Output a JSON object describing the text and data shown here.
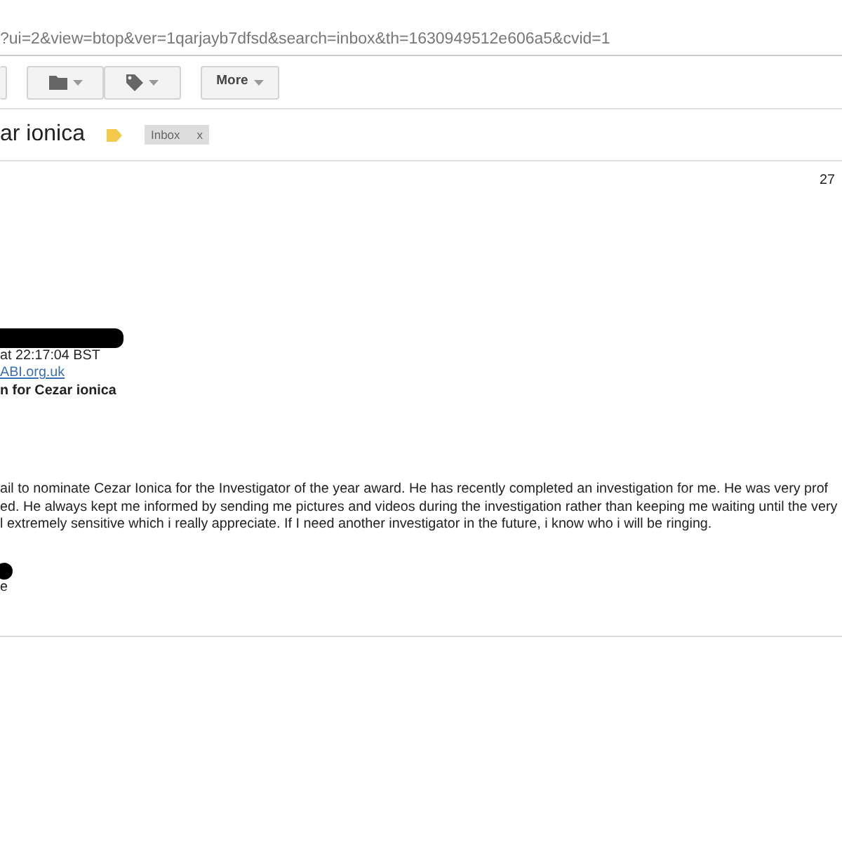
{
  "address_bar": {
    "url": "?ui=2&view=btop&ver=1qarjayb7dfsd&search=inbox&th=1630949512e606a5&cvid=1"
  },
  "toolbar": {
    "buttons": [
      {
        "kind": "stub"
      },
      {
        "kind": "folder"
      },
      {
        "kind": "label"
      },
      {
        "kind": "text",
        "label": "More"
      }
    ]
  },
  "subject": {
    "title": "ar ionica",
    "important": true,
    "labels": [
      {
        "name": "Inbox",
        "close": "x"
      }
    ]
  },
  "message": {
    "date": "27",
    "header_lines": [
      {
        "kind": "redacted"
      },
      {
        "kind": "text",
        "text": "at 22:17:04 BST"
      },
      {
        "kind": "link",
        "text": "ABI.org.uk"
      },
      {
        "kind": "bold",
        "text": "n for Cezar ionica"
      }
    ],
    "body": [
      "ail to nominate Cezar Ionica for the Investigator of the year award. He has recently completed an investigation for me. He was very prof",
      "ed. He always kept me informed by sending me pictures and videos during the investigation rather than keeping me waiting until the very",
      "l extremely sensitive which i really appreciate. If I need another investigator in the future, i know who i will be ringing."
    ],
    "signature": [
      {
        "kind": "redacted"
      },
      {
        "kind": "text",
        "text": "e"
      }
    ]
  }
}
